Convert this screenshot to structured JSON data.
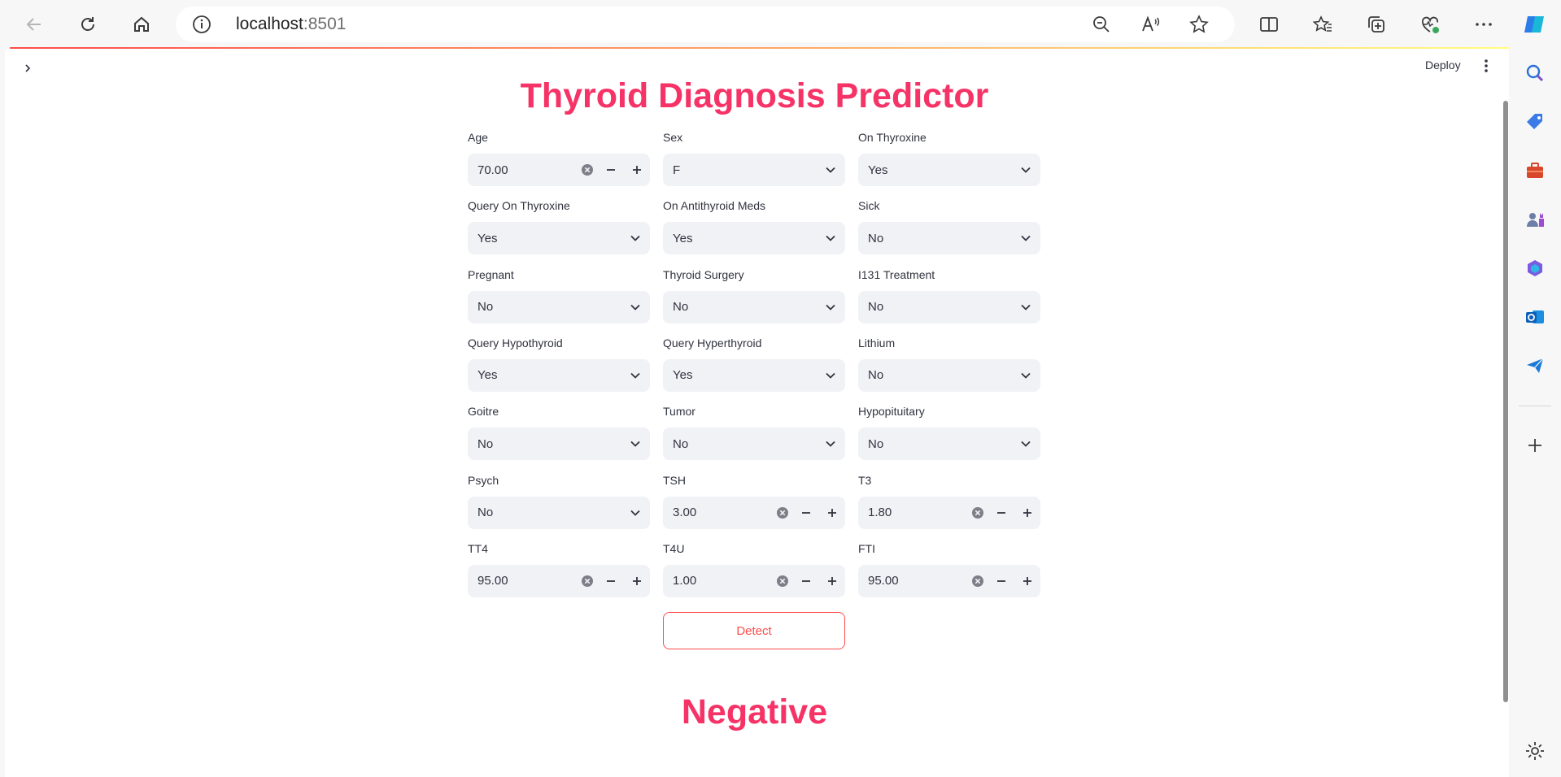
{
  "browser": {
    "url_host": "localhost",
    "url_port": ":8501"
  },
  "app": {
    "deploy_label": "Deploy",
    "title": "Thyroid Diagnosis Predictor",
    "detect_label": "Detect",
    "result": "Negative",
    "accent_color": "#f63366",
    "button_color": "#ff4b4b"
  },
  "fields": [
    {
      "label": "Age",
      "type": "number",
      "value": "70.00"
    },
    {
      "label": "Sex",
      "type": "select",
      "value": "F"
    },
    {
      "label": "On Thyroxine",
      "type": "select",
      "value": "Yes"
    },
    {
      "label": "Query On Thyroxine",
      "type": "select",
      "value": "Yes"
    },
    {
      "label": "On Antithyroid Meds",
      "type": "select",
      "value": "Yes"
    },
    {
      "label": "Sick",
      "type": "select",
      "value": "No"
    },
    {
      "label": "Pregnant",
      "type": "select",
      "value": "No"
    },
    {
      "label": "Thyroid Surgery",
      "type": "select",
      "value": "No"
    },
    {
      "label": "I131 Treatment",
      "type": "select",
      "value": "No"
    },
    {
      "label": "Query Hypothyroid",
      "type": "select",
      "value": "Yes"
    },
    {
      "label": "Query Hyperthyroid",
      "type": "select",
      "value": "Yes"
    },
    {
      "label": "Lithium",
      "type": "select",
      "value": "No"
    },
    {
      "label": "Goitre",
      "type": "select",
      "value": "No"
    },
    {
      "label": "Tumor",
      "type": "select",
      "value": "No"
    },
    {
      "label": "Hypopituitary",
      "type": "select",
      "value": "No"
    },
    {
      "label": "Psych",
      "type": "select",
      "value": "No"
    },
    {
      "label": "TSH",
      "type": "number",
      "value": "3.00"
    },
    {
      "label": "T3",
      "type": "number",
      "value": "1.80"
    },
    {
      "label": "TT4",
      "type": "number",
      "value": "95.00"
    },
    {
      "label": "T4U",
      "type": "number",
      "value": "1.00"
    },
    {
      "label": "FTI",
      "type": "number",
      "value": "95.00"
    }
  ]
}
